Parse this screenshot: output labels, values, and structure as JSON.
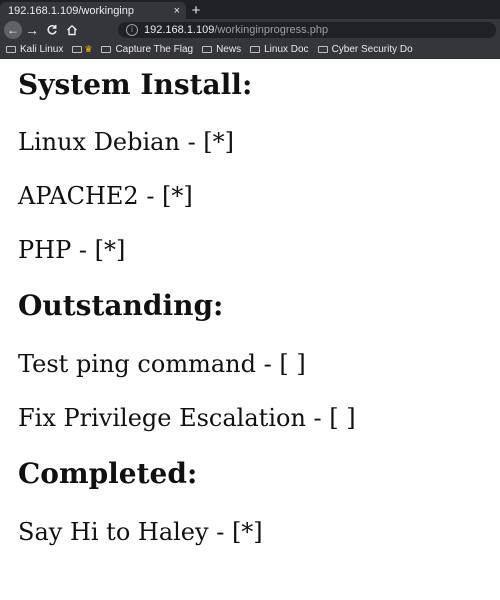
{
  "browser": {
    "tab_title": "192.168.1.109/workinginp",
    "tab_close": "×",
    "new_tab": "+",
    "url_host": "192.168.1.109",
    "url_path": "/workinginprogress.php",
    "bookmarks": [
      {
        "label": "Kali Linux",
        "icon": "folder-icon"
      },
      {
        "label": "",
        "icon": "crown-folder-icon"
      },
      {
        "label": "Capture The Flag",
        "icon": "folder-icon"
      },
      {
        "label": "News",
        "icon": "folder-icon"
      },
      {
        "label": "Linux Doc",
        "icon": "folder-icon"
      },
      {
        "label": "Cyber Security Do",
        "icon": "folder-icon"
      }
    ]
  },
  "page": {
    "sections": [
      {
        "heading": "System Install:",
        "items": [
          "Linux Debian - [*]",
          "APACHE2 - [*]",
          "PHP - [*]"
        ]
      },
      {
        "heading": "Outstanding:",
        "items": [
          "Test ping command - [ ]",
          "Fix Privilege Escalation - [ ]"
        ]
      },
      {
        "heading": "Completed:",
        "items": [
          "Say Hi to Haley - [*]"
        ]
      }
    ]
  }
}
